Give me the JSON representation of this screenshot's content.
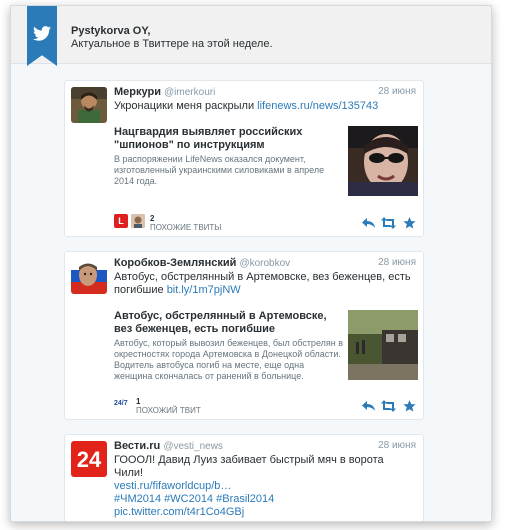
{
  "header": {
    "user_name": "Pystykorva OY,",
    "subtitle": "Актуальное в Твиттере на этой неделе."
  },
  "colors": {
    "accent": "#2b7bb9",
    "ribbon": "#2b7bb9"
  },
  "tweets": [
    {
      "name": "Меркури",
      "handle": "@imerkouri",
      "date": "28 июня",
      "text": "Укронацики меня раскрыли ",
      "link": "lifenews.ru/news/135743",
      "card_title": "Нацгвардия выявляет российских \"шпионов\" по инструкциям",
      "card_desc": "В распоряжении LifeNews оказался документ, изготовленный украинскими силовиками в апреле 2014 года.",
      "count": "2",
      "count_label": "ПОХОЖИЕ ТВИТЫ"
    },
    {
      "name": "Коробков-Землянский",
      "handle": "@korobkov",
      "date": "28 июня",
      "text": "Автобус, обстрелянный в Артемовске, вез беженцев, есть погибшие ",
      "link": "bit.ly/1m7pjNW",
      "card_title": "Автобус, обстрелянный в Артемовске, вез беженцев, есть погибшие",
      "card_desc": "Автобус, который вывозил беженцев, был обстрелян в окрестностях города Артемовска в Донецкой области. Водитель автобуса погиб на месте, еще одна женщина скончалась от ранений в больнице.",
      "count": "1",
      "count_label": "ПОХОЖИЙ ТВИТ"
    },
    {
      "name": "Вести.ru",
      "handle": "@vesti_news",
      "date": "28 июня",
      "text": "ГОООЛ! Давид Луиз забивает быстрый мяч в ворота Чили!",
      "link": "vesti.ru/fifaworldcup/b…",
      "hashtags": "#ЧМ2014 #WC2014 #Brasil2014",
      "pic": "pic.twitter.com/t4r1Co4GBj"
    }
  ],
  "icons": [
    "twitter-bird-icon",
    "reply-icon",
    "retweet-icon",
    "favorite-icon"
  ]
}
